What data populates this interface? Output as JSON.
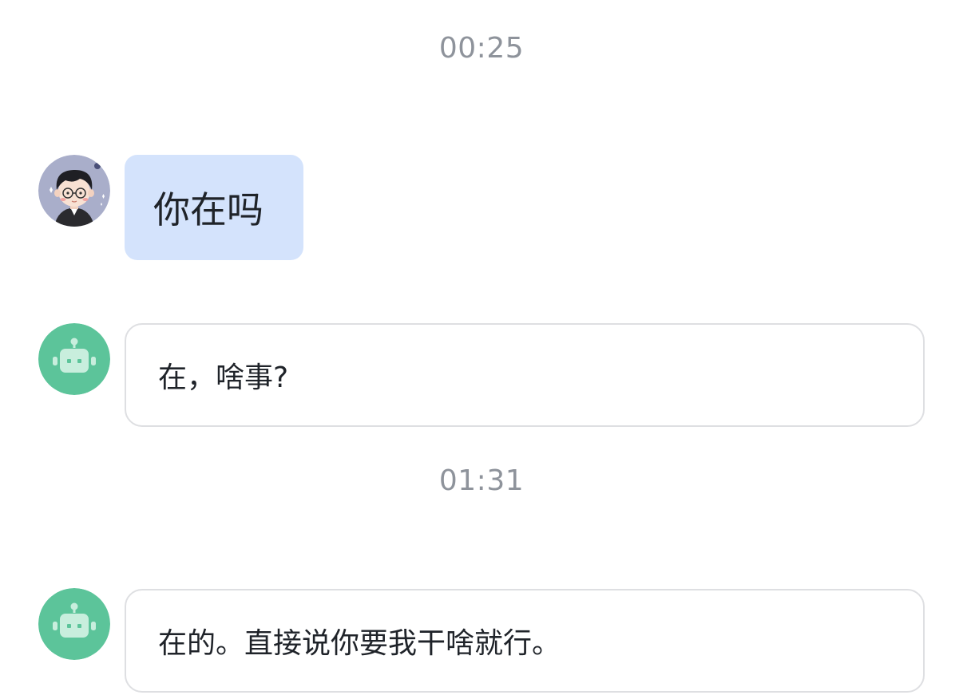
{
  "messages": [
    {
      "type": "timestamp",
      "text": "00:25"
    },
    {
      "type": "user",
      "text": "你在吗"
    },
    {
      "type": "bot",
      "text": "在，啥事?"
    },
    {
      "type": "timestamp",
      "text": "01:31"
    },
    {
      "type": "bot",
      "text": "在的。直接说你要我干啥就行。"
    }
  ],
  "icons": {
    "user_avatar": "cartoon-boy-avatar-icon",
    "bot_avatar": "robot-avatar-icon"
  },
  "colors": {
    "user_bubble": "#d4e3fc",
    "bot_avatar": "#5cc49a",
    "bot_border": "#dedfe2",
    "timestamp": "#8e939b",
    "text": "#1f2329"
  }
}
